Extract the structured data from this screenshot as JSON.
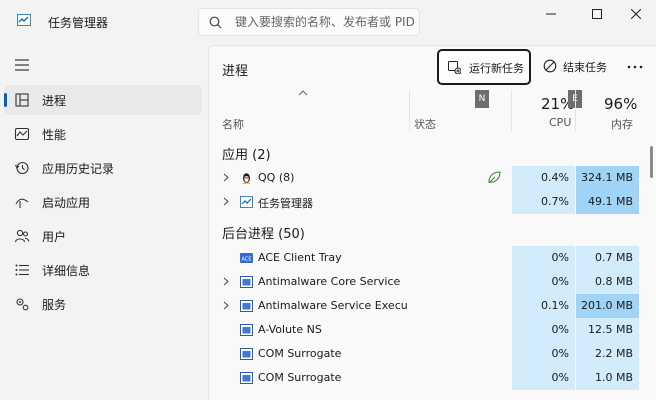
{
  "window": {
    "title": "任务管理器",
    "search_placeholder": "键入要搜索的名称、发布者或 PID"
  },
  "sidebar": {
    "items": [
      {
        "label": "进程",
        "icon": "processes-icon",
        "active": true
      },
      {
        "label": "性能",
        "icon": "performance-icon",
        "active": false
      },
      {
        "label": "应用历史记录",
        "icon": "app-history-icon",
        "active": false
      },
      {
        "label": "启动应用",
        "icon": "startup-apps-icon",
        "active": false
      },
      {
        "label": "用户",
        "icon": "users-icon",
        "active": false
      },
      {
        "label": "详细信息",
        "icon": "details-icon",
        "active": false
      },
      {
        "label": "服务",
        "icon": "services-icon",
        "active": false
      }
    ]
  },
  "main": {
    "title": "进程",
    "run_new_task_label": "运行新任务",
    "end_task_label": "结束任务",
    "columns": {
      "name": "名称",
      "status": "状态",
      "cpu_pct": "21%",
      "cpu": "CPU",
      "mem_pct": "96%",
      "mem": "内存",
      "badge_n": "N",
      "badge_e": "E"
    },
    "groups": [
      {
        "label": "应用 (2)",
        "rows": [
          {
            "name": "QQ (8)",
            "icon": "qq-penguin-icon",
            "expandable": true,
            "status": "efficiency-leaf-icon",
            "cpu": "0.4%",
            "mem": "324.1 MB",
            "mem_hi": true
          },
          {
            "name": "任务管理器",
            "icon": "task-manager-icon",
            "expandable": true,
            "status": "",
            "cpu": "0.7%",
            "mem": "49.1 MB",
            "mem_hi": true
          }
        ]
      },
      {
        "label": "后台进程 (50)",
        "rows": [
          {
            "name": "ACE Client Tray",
            "icon": "ace-icon",
            "expandable": false,
            "status": "",
            "cpu": "0%",
            "mem": "0.7 MB",
            "mem_hi": false
          },
          {
            "name": "Antimalware Core Service",
            "icon": "window-icon",
            "expandable": true,
            "status": "",
            "cpu": "0%",
            "mem": "0.8 MB",
            "mem_hi": false
          },
          {
            "name": "Antimalware Service Execut...",
            "icon": "window-icon",
            "expandable": true,
            "status": "",
            "cpu": "0.1%",
            "mem": "201.0 MB",
            "mem_hi": true
          },
          {
            "name": "A-Volute NS",
            "icon": "window-icon",
            "expandable": false,
            "status": "",
            "cpu": "0%",
            "mem": "12.5 MB",
            "mem_hi": false
          },
          {
            "name": "COM Surrogate",
            "icon": "window-icon",
            "expandable": false,
            "status": "",
            "cpu": "0%",
            "mem": "2.2 MB",
            "mem_hi": false
          },
          {
            "name": "COM Surrogate",
            "icon": "window-icon",
            "expandable": false,
            "status": "",
            "cpu": "0%",
            "mem": "1.0 MB",
            "mem_hi": false
          }
        ]
      }
    ]
  }
}
